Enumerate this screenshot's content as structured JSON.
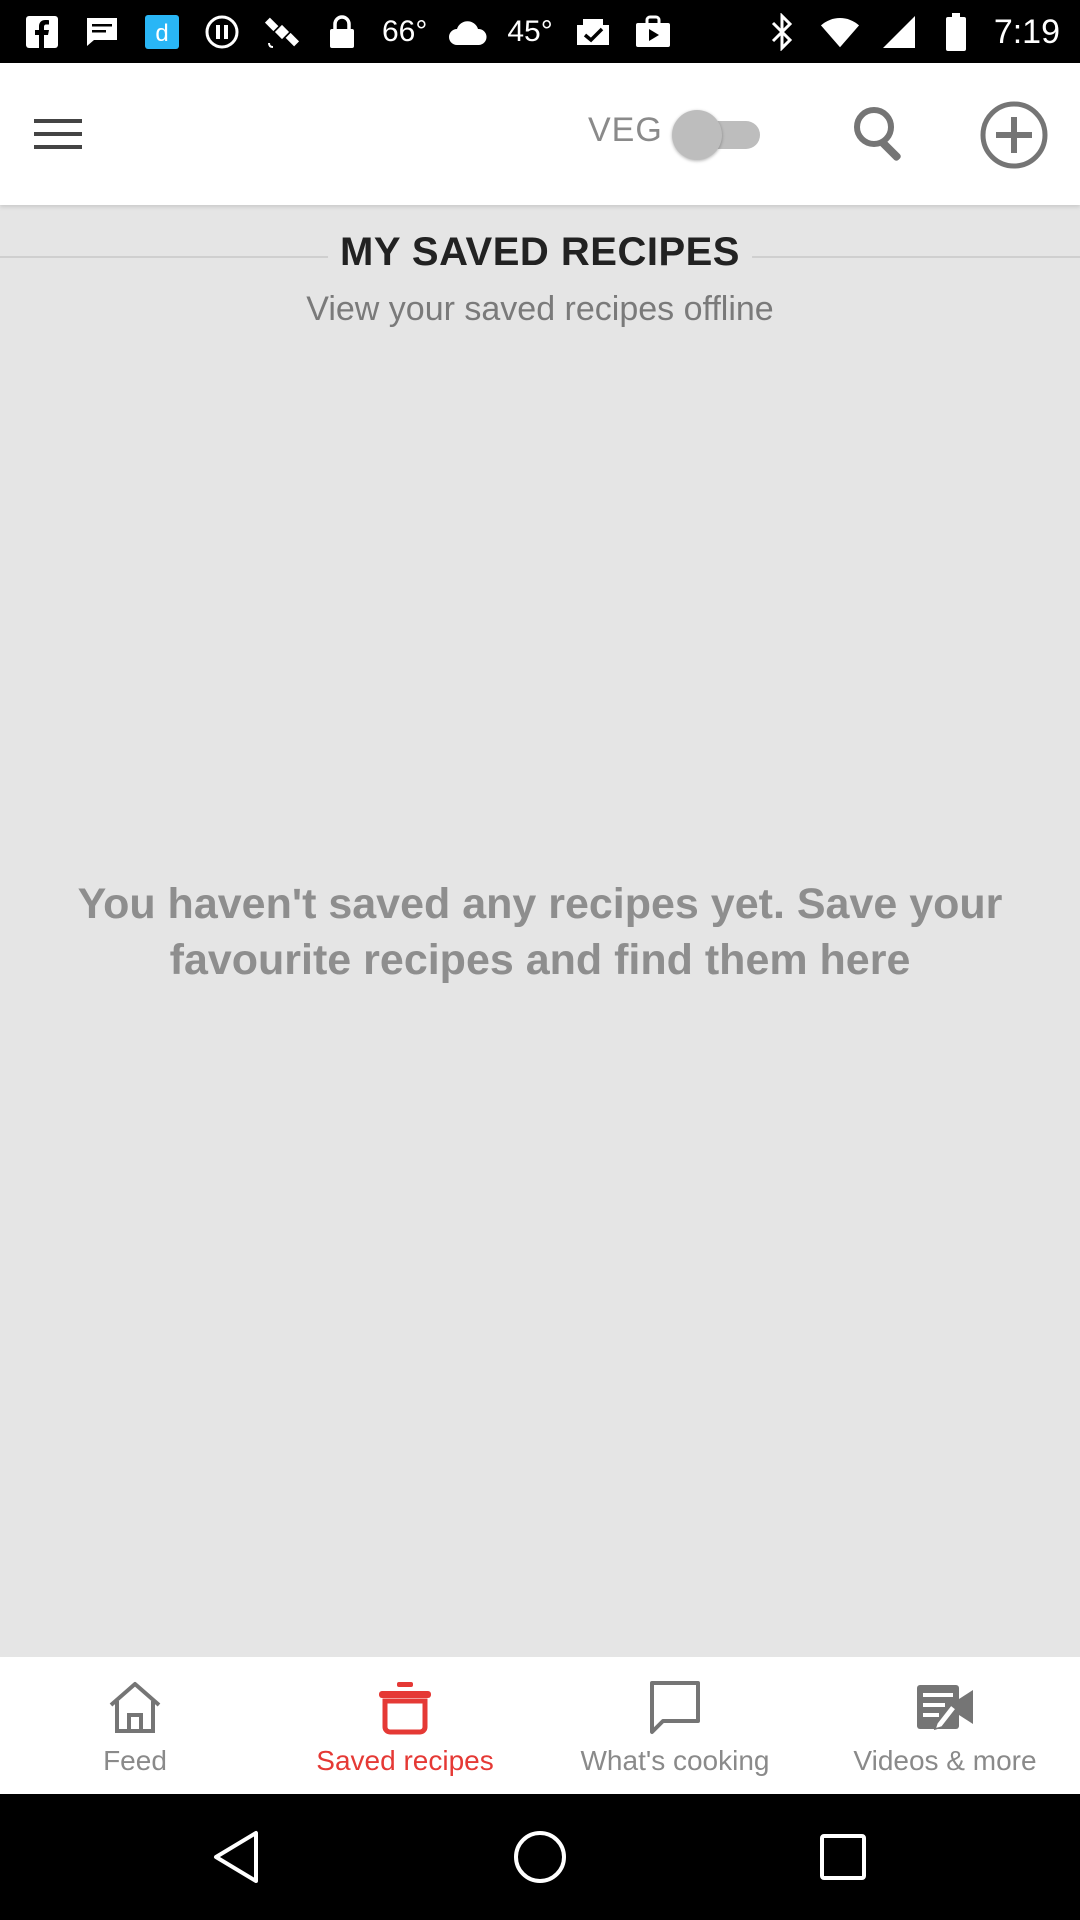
{
  "status_bar": {
    "temperature_1": "66°",
    "temperature_2": "45°",
    "time": "7:19"
  },
  "app_bar": {
    "veg_label": "VEG",
    "veg_toggle_on": false
  },
  "section": {
    "title": "MY SAVED RECIPES",
    "subtitle": "View your saved recipes offline"
  },
  "empty_state": {
    "message": "You haven't saved any recipes yet. Save your favourite recipes and find them here"
  },
  "bottom_nav": {
    "items": [
      {
        "label": "Feed",
        "icon": "home-icon"
      },
      {
        "label": "Saved recipes",
        "icon": "pot-icon",
        "active": true
      },
      {
        "label": "What's cooking",
        "icon": "chat-icon"
      },
      {
        "label": "Videos & more",
        "icon": "video-icon"
      }
    ]
  },
  "colors": {
    "accent": "#e53935",
    "background": "#e5e5e5",
    "icon_gray": "#757575"
  }
}
